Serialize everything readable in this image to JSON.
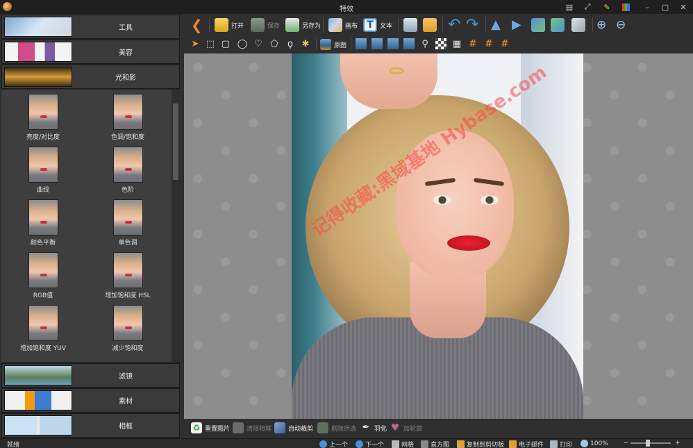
{
  "window": {
    "title": "特效"
  },
  "left_panel": {
    "categories_top": [
      {
        "label": "工具",
        "thumb": "planes-thumbnail"
      },
      {
        "label": "美容",
        "thumb": "cosmetics-thumbnail"
      },
      {
        "label": "光和影",
        "thumb": "sunset-thumbnail"
      }
    ],
    "effects": [
      {
        "label": "亮度/对比度"
      },
      {
        "label": "色调/饱和度"
      },
      {
        "label": "曲线"
      },
      {
        "label": "色阶"
      },
      {
        "label": "颜色平衡"
      },
      {
        "label": "单色调"
      },
      {
        "label": "RGB值"
      },
      {
        "label": "增加饱和度 HSL"
      },
      {
        "label": "增加饱和度 YUV"
      },
      {
        "label": "减少饱和度"
      }
    ],
    "categories_bottom": [
      {
        "label": "滤镜",
        "thumb": "landscape-thumbnail"
      },
      {
        "label": "素材",
        "thumb": "stickers-thumbnail"
      },
      {
        "label": "相框",
        "thumb": "frames-thumbnail"
      }
    ]
  },
  "toolbar": {
    "back_icon": "back-arrow-icon",
    "open_label": "打开",
    "save_label": "保存",
    "saveas_label": "另存为",
    "canvas_label": "画布",
    "text_label": "文本",
    "original_label": "原图"
  },
  "canvas": {
    "watermark_text": "记得收藏:黑域基地 Hybase.com"
  },
  "bottom_toolbar": {
    "redraw_label": "重置图片",
    "clear_frame_label": "清除相框",
    "auto_crop_label": "自动裁剪",
    "delete_selection_label": "删除所选",
    "feather_label": "羽化",
    "outline_label": "加轮廓"
  },
  "status_bar": {
    "status_text": "就绪",
    "prev_label": "上一个",
    "next_label": "下一个",
    "grid_label": "网格",
    "histogram_label": "直方图",
    "copy_label": "复制到剪切板",
    "email_label": "电子邮件",
    "print_label": "打印",
    "zoom_text": "100%",
    "zoom_minus": "−",
    "zoom_plus": "+"
  }
}
